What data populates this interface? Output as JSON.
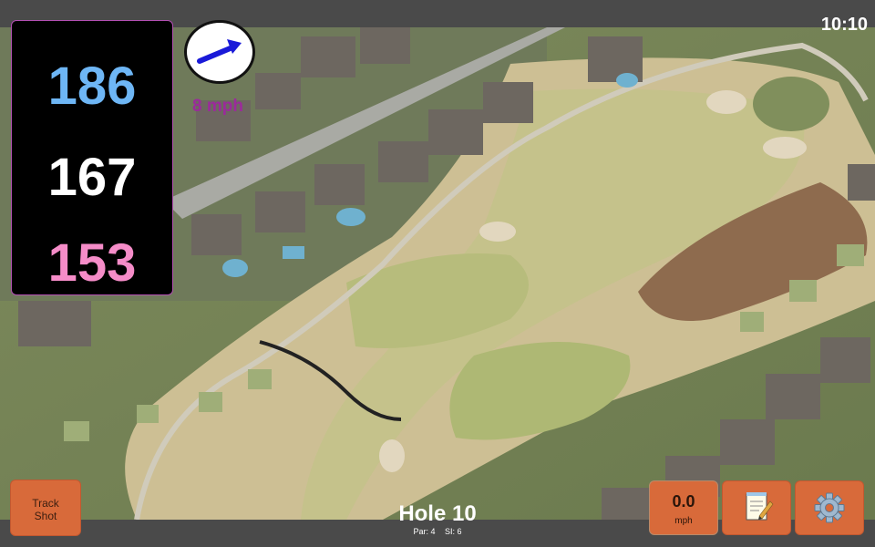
{
  "status_bar": {
    "time": "10:10"
  },
  "distances": {
    "back": "186",
    "middle": "167",
    "front": "153"
  },
  "wind": {
    "speed": "8 mph",
    "icon": "wind-arrow-icon",
    "arrow_color": "#1a1ad8"
  },
  "buttons": {
    "track_shot": {
      "line1": "Track",
      "line2": "Shot"
    },
    "speed": {
      "value": "0.0",
      "unit": "mph"
    },
    "notes_icon": "notepad-icon",
    "settings_icon": "gear-icon"
  },
  "hole": {
    "title": "Hole 10",
    "par_label": "Par: 4",
    "si_label": "SI: 6"
  },
  "colors": {
    "accent_orange": "#d86a3a",
    "back_color": "#6eb6f5",
    "middle_color": "#ffffff",
    "front_color": "#f58cc8",
    "wind_text": "#9b2a9b"
  }
}
